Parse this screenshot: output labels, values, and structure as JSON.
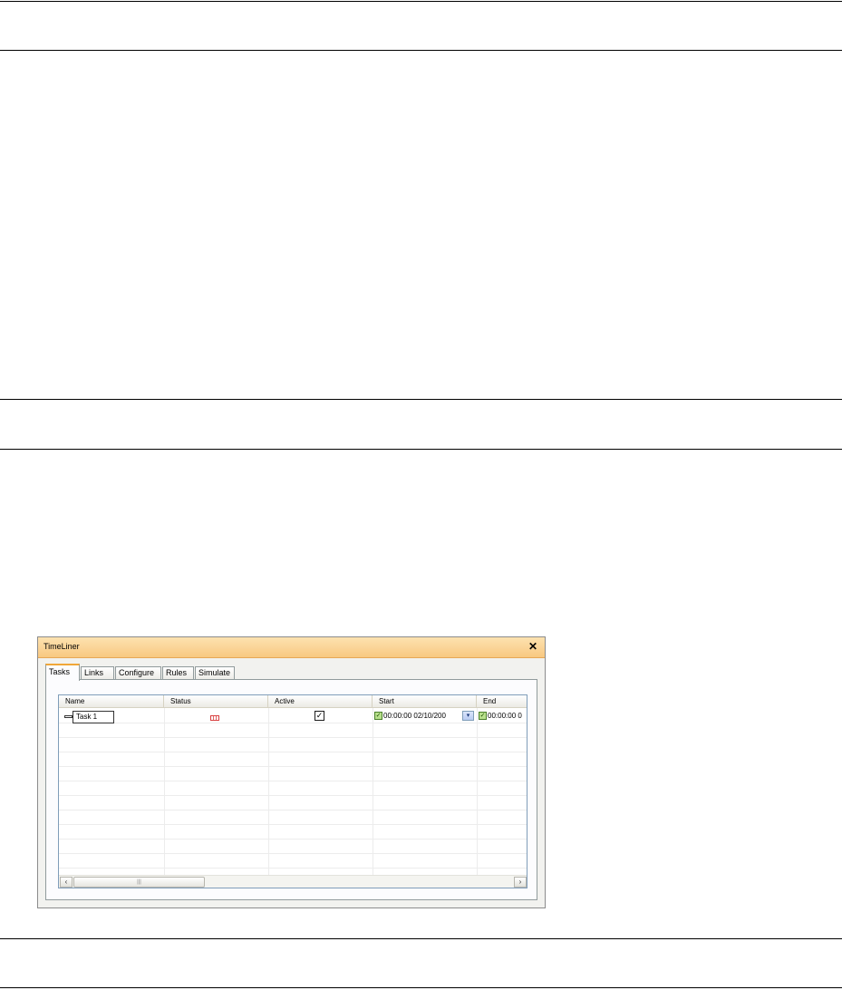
{
  "panel": {
    "title": "TimeLiner",
    "close_glyph": "✕",
    "tabs": [
      {
        "label": "Tasks",
        "active": true
      },
      {
        "label": "Links",
        "active": false
      },
      {
        "label": "Configure",
        "active": false
      },
      {
        "label": "Rules",
        "active": false
      },
      {
        "label": "Simulate",
        "active": false
      }
    ],
    "grid": {
      "columns": [
        "Name",
        "Status",
        "Active",
        "Start",
        "End"
      ],
      "rows": [
        {
          "name": "Task 1",
          "status_icon": "planned-status-icon",
          "active": true,
          "active_glyph": "✓",
          "start": "00:00:00 02/10/200",
          "end": "00:00:00 0"
        }
      ],
      "date_check_glyph": "✓",
      "dropdown_glyph": "▾",
      "scroll_left_glyph": "‹",
      "scroll_right_glyph": "›",
      "thumb_grip": "|||"
    }
  },
  "colors": {
    "title_bar": "#f8c881",
    "tab_accent": "#f1a738",
    "grid_border": "#7f9db9"
  }
}
